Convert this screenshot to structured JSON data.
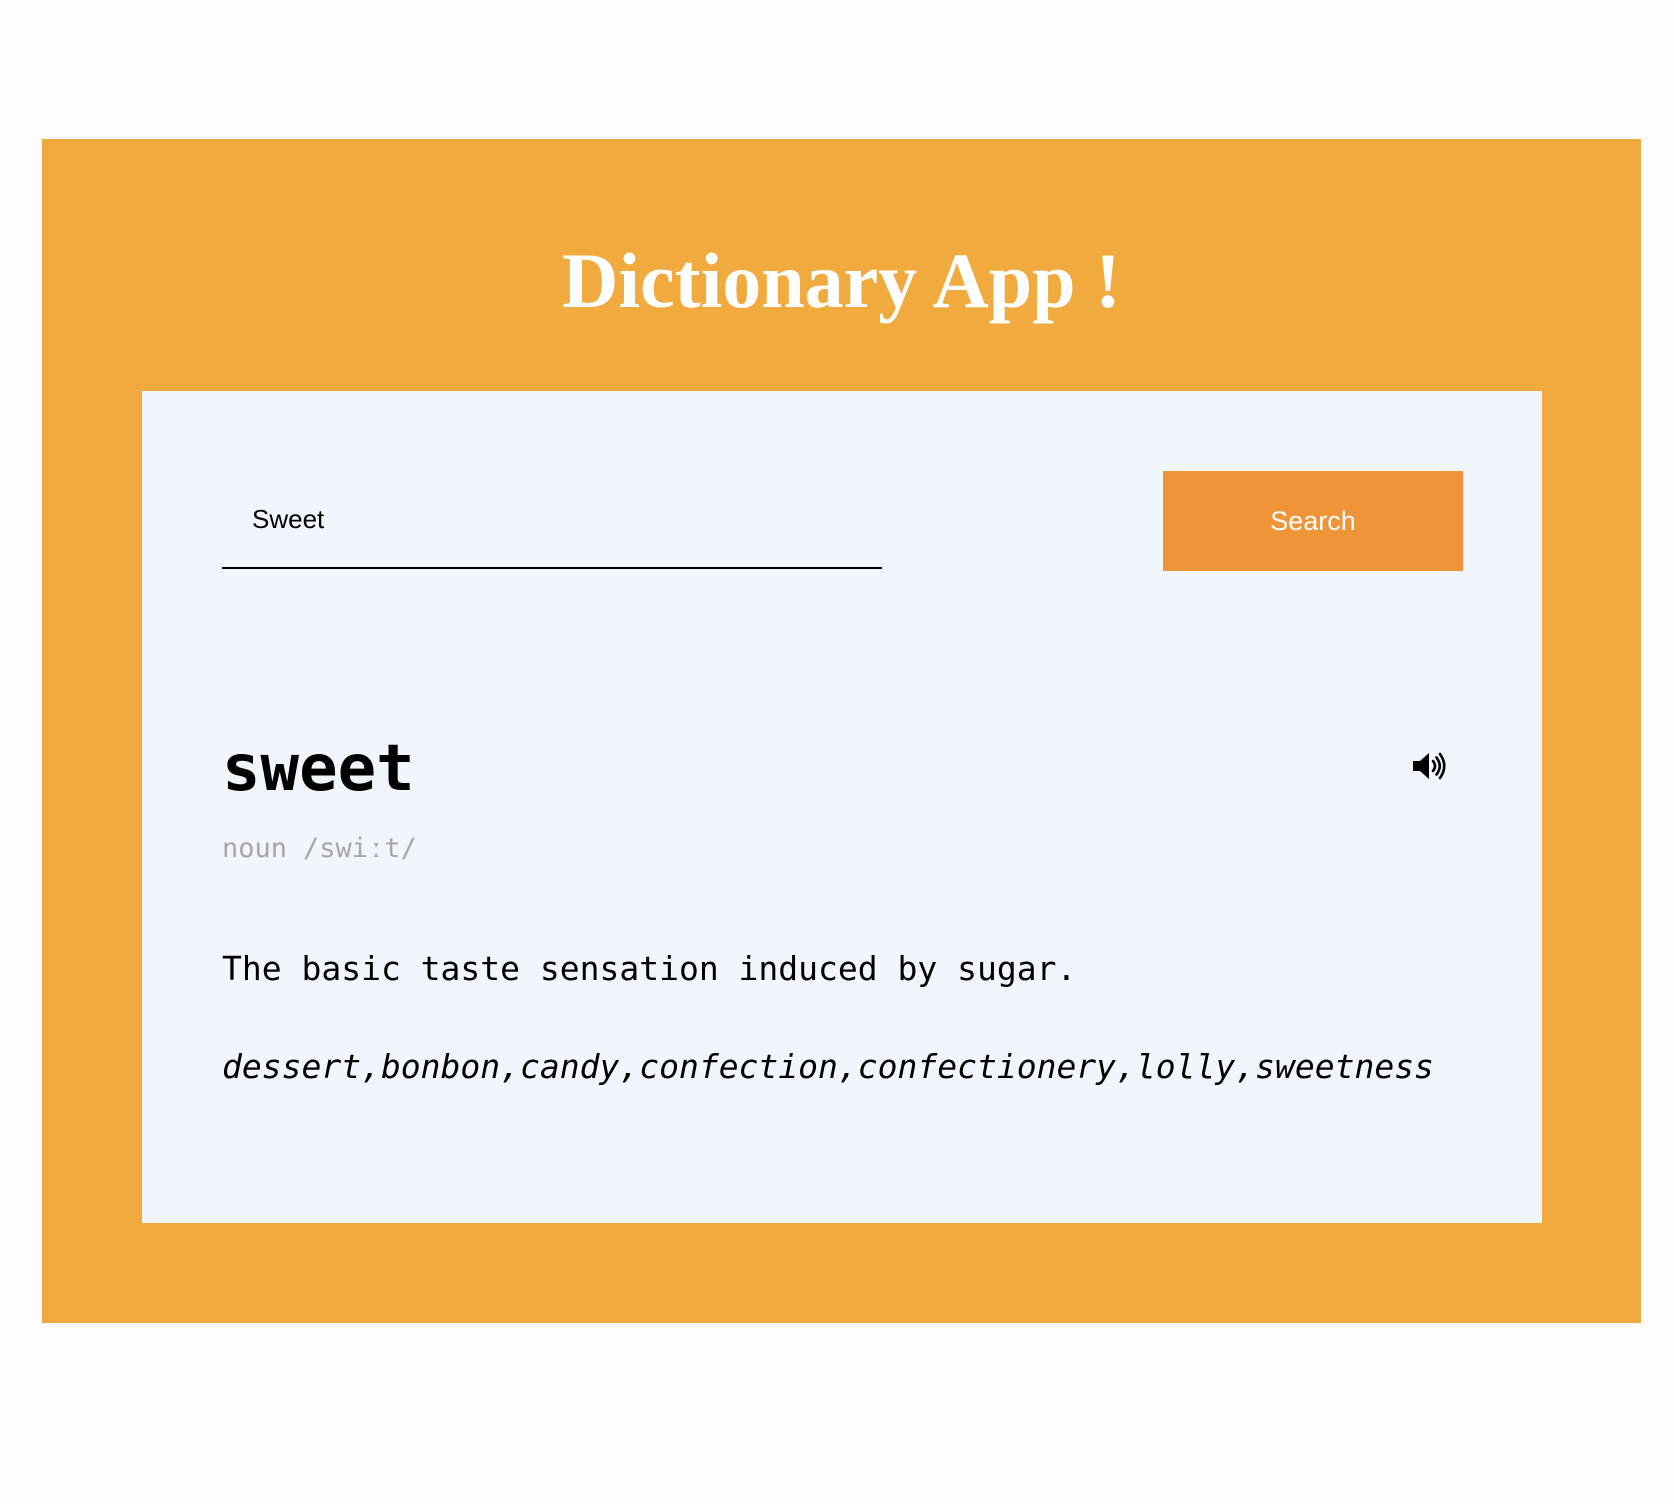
{
  "app": {
    "title": "Dictionary App !",
    "accent_color": "#f0aa3e",
    "button_color": "#f09438",
    "panel_color": "#f0f6fc"
  },
  "search": {
    "value": "Sweet",
    "button_label": "Search"
  },
  "result": {
    "word": "sweet",
    "part_of_speech": "noun",
    "phonetic": "/swiːt/",
    "audio_icon": "speaker-icon",
    "definition": "The basic taste sensation induced by sugar.",
    "synonyms": "dessert,bonbon,candy,confection,confectionery,lolly,sweetness"
  }
}
